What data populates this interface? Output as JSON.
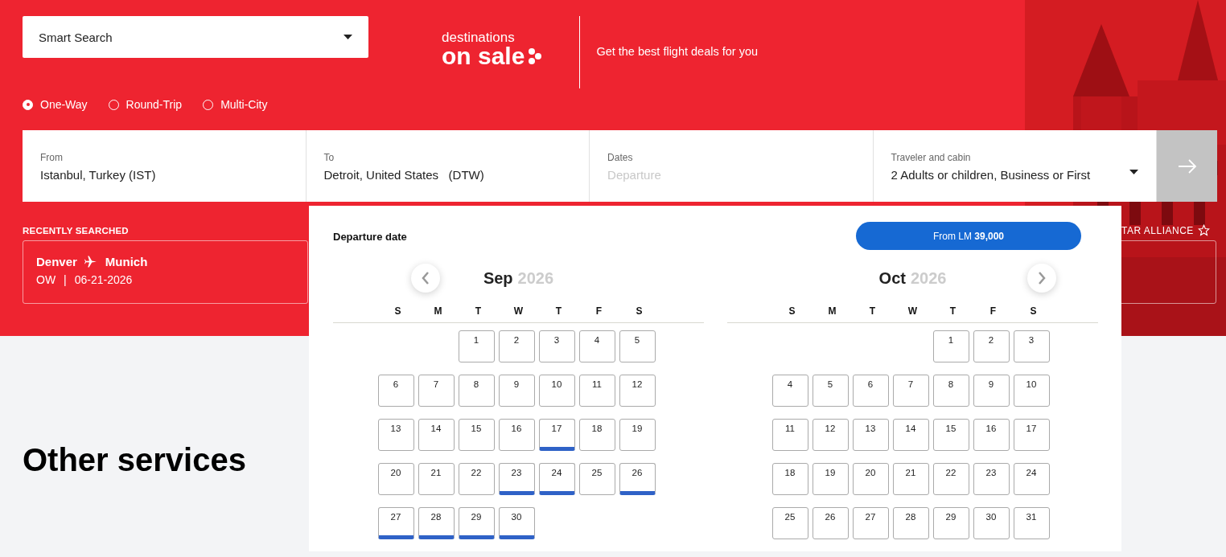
{
  "smart_search": {
    "value": "Smart Search"
  },
  "logo": {
    "line_1": "destinations",
    "line_2": "on sale"
  },
  "tagline": "Get the best flight deals for you",
  "trip_types": [
    {
      "label": "One-Way",
      "selected": true
    },
    {
      "label": "Round-Trip",
      "selected": false
    },
    {
      "label": "Multi-City",
      "selected": false
    }
  ],
  "search_fields": [
    {
      "label": "From",
      "value": "Istanbul, Turkey (IST)"
    },
    {
      "label": "To",
      "value": "Detroit, United States   (DTW)"
    },
    {
      "label": "Dates",
      "placeholder": "Departure"
    },
    {
      "label": "Traveler and cabin",
      "value": "2 Adults or children, Business or First",
      "kind": "dropdown"
    }
  ],
  "recently_searched": {
    "title": "RECENTLY SEARCHED",
    "items": [
      {
        "origin": "Denver",
        "destination": "Munich",
        "trip": "OW",
        "separator": "|",
        "date": "06-21-2026"
      }
    ]
  },
  "alliance_text": "TAR ALLIANCE",
  "other_services": "Other services",
  "date_picker": {
    "title": "Departure date",
    "price_button": "From LM **39,000**",
    "months": [
      {
        "month": "Sep",
        "year": "2026",
        "weekdays": [
          "S",
          "M",
          "T",
          "W",
          "T",
          "F",
          "S"
        ],
        "weeks": [
          [
            {
              "day": "1",
              "deal": false
            },
            {
              "day": "2",
              "deal": false
            },
            {
              "day": "3",
              "deal": false
            },
            {
              "day": "4",
              "deal": false
            },
            {
              "day": "5",
              "deal": false
            }
          ],
          [
            {
              "day": "6",
              "deal": false
            },
            {
              "day": "7",
              "deal": false
            },
            {
              "day": "8",
              "deal": false
            },
            {
              "day": "9",
              "deal": false
            },
            {
              "day": "10",
              "deal": false
            },
            {
              "day": "11",
              "deal": false
            },
            {
              "day": "12",
              "deal": false
            }
          ],
          [
            {
              "day": "13",
              "deal": false
            },
            {
              "day": "14",
              "deal": false
            },
            {
              "day": "15",
              "deal": false
            },
            {
              "day": "16",
              "deal": false
            },
            {
              "day": "17",
              "deal": true
            },
            {
              "day": "18",
              "deal": false
            },
            {
              "day": "19",
              "deal": false
            }
          ],
          [
            {
              "day": "20",
              "deal": false
            },
            {
              "day": "21",
              "deal": false
            },
            {
              "day": "22",
              "deal": false
            },
            {
              "day": "23",
              "deal": true
            },
            {
              "day": "24",
              "deal": true
            },
            {
              "day": "25",
              "deal": false
            },
            {
              "day": "26",
              "deal": true
            }
          ],
          [
            {
              "day": "27",
              "deal": true
            },
            {
              "day": "28",
              "deal": true
            },
            {
              "day": "29",
              "deal": true
            },
            {
              "day": "30",
              "deal": true
            }
          ]
        ]
      },
      {
        "month": "Oct",
        "year": "2026",
        "weekdays": [
          "S",
          "M",
          "T",
          "W",
          "T",
          "F",
          "S"
        ],
        "weeks": [
          [
            {
              "day": "1",
              "deal": false
            },
            {
              "day": "2",
              "deal": false
            },
            {
              "day": "3",
              "deal": false
            }
          ],
          [
            {
              "day": "4",
              "deal": false
            },
            {
              "day": "5",
              "deal": false
            },
            {
              "day": "6",
              "deal": false
            },
            {
              "day": "7",
              "deal": false
            },
            {
              "day": "8",
              "deal": false
            },
            {
              "day": "9",
              "deal": false
            },
            {
              "day": "10",
              "deal": false
            }
          ],
          [
            {
              "day": "11",
              "deal": false
            },
            {
              "day": "12",
              "deal": false
            },
            {
              "day": "13",
              "deal": false
            },
            {
              "day": "14",
              "deal": false
            },
            {
              "day": "15",
              "deal": false
            },
            {
              "day": "16",
              "deal": false
            },
            {
              "day": "17",
              "deal": false
            }
          ],
          [
            {
              "day": "18",
              "deal": false
            },
            {
              "day": "19",
              "deal": false
            },
            {
              "day": "20",
              "deal": false
            },
            {
              "day": "21",
              "deal": false
            },
            {
              "day": "22",
              "deal": false
            },
            {
              "day": "23",
              "deal": false
            },
            {
              "day": "24",
              "deal": false
            }
          ],
          [
            {
              "day": "25",
              "deal": false
            },
            {
              "day": "26",
              "deal": false
            },
            {
              "day": "27",
              "deal": false
            },
            {
              "day": "28",
              "deal": false
            },
            {
              "day": "29",
              "deal": false
            },
            {
              "day": "30",
              "deal": false
            },
            {
              "day": "31",
              "deal": false
            }
          ]
        ]
      }
    ]
  }
}
